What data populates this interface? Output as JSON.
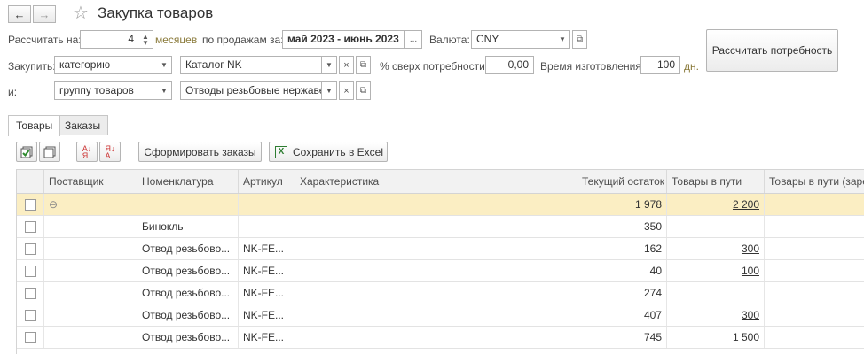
{
  "window": {
    "title": "Закупка товаров",
    "back_icon": "arrow-left-icon",
    "forward_icon": "arrow-right-icon",
    "favorite_icon": "star-icon"
  },
  "form": {
    "calc_for_label": "Рассчитать на:",
    "calc_for_value": "4",
    "months_label": "месяцев",
    "by_sales_label": "по продажам за:",
    "period_value": "май 2023 - июнь 2023",
    "period_button": "...",
    "currency_label": "Валюта:",
    "currency_value": "CNY",
    "buy_label": "Закупить:",
    "buy_type_value": "категорию",
    "buy_value": "Каталог NK",
    "extra_label": "% сверх потребности:",
    "extra_value": "0,00",
    "production_label": "Время изготовления:",
    "production_value": "100",
    "days_label": "дн.",
    "and_label": "и:",
    "and_type_value": "группу товаров",
    "and_value": "Отводы резьбовые нержавею",
    "clear_symbol": "×",
    "calc_button": "Рассчитать потребность"
  },
  "tabs": [
    {
      "label": "Товары",
      "active": true
    },
    {
      "label": "Заказы",
      "active": false
    }
  ],
  "toolbar": {
    "check_all_icon": "check-all-icon",
    "uncheck_all_icon": "uncheck-all-icon",
    "sort_asc_icon": "sort-asc-icon",
    "sort_desc_icon": "sort-desc-icon",
    "form_orders_label": "Сформировать заказы",
    "save_excel_label": "Сохранить в Excel"
  },
  "table": {
    "headers": [
      "Поставщик",
      "Номенклатура",
      "Артикул",
      "Характеристика",
      "Текущий остаток",
      "Товары в пути",
      "Товары в пути (зарез"
    ],
    "group_row": {
      "toggle": "⊖",
      "stock": "1 978",
      "in_transit": "2 200"
    },
    "rows": [
      {
        "nomenclature": "Бинокль",
        "article": "",
        "stock": "350",
        "in_transit": ""
      },
      {
        "nomenclature": "Отвод резьбово...",
        "article": "NK-FE...",
        "stock": "162",
        "in_transit": "300"
      },
      {
        "nomenclature": "Отвод резьбово...",
        "article": "NK-FE...",
        "stock": "40",
        "in_transit": "100"
      },
      {
        "nomenclature": "Отвод резьбово...",
        "article": "NK-FE...",
        "stock": "274",
        "in_transit": ""
      },
      {
        "nomenclature": "Отвод резьбово...",
        "article": "NK-FE...",
        "stock": "407",
        "in_transit": "300"
      },
      {
        "nomenclature": "Отвод резьбово...",
        "article": "NK-FE...",
        "stock": "745",
        "in_transit": "1 500"
      }
    ]
  },
  "colors": {
    "group_row_bg": "#fbeec3",
    "accent_text": "#8a7a3a"
  }
}
